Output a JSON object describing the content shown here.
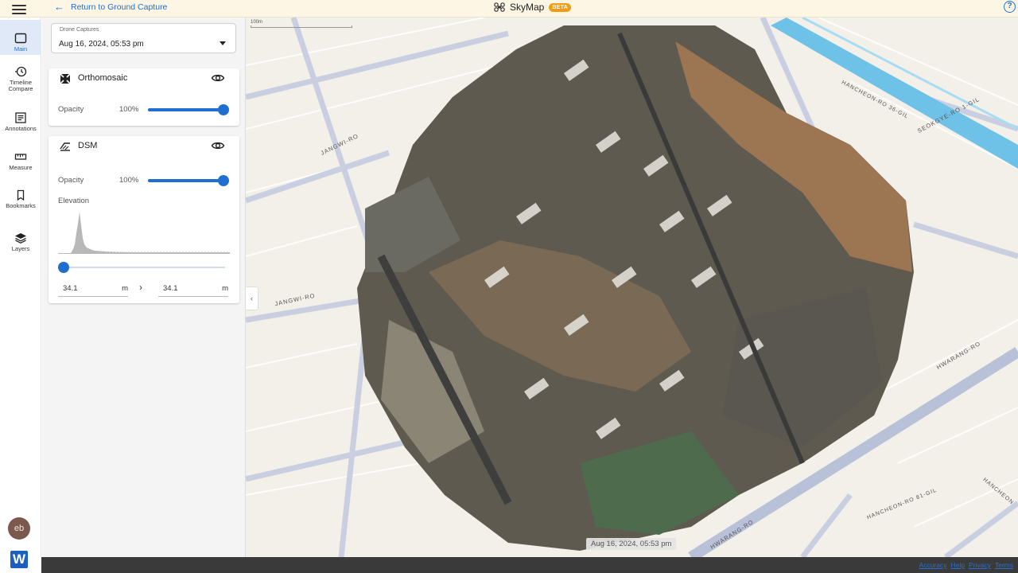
{
  "header": {
    "back_label": "Return to Ground Capture",
    "app_name": "SkyMap",
    "beta_badge": "BETA",
    "help_label": "?"
  },
  "rail": {
    "items": [
      {
        "label": "Main",
        "icon": "square-icon",
        "active": true
      },
      {
        "label": "Timeline Compare",
        "icon": "clock-history-icon"
      },
      {
        "label": "Annotations",
        "icon": "list-doc-icon"
      },
      {
        "label": "Measure",
        "icon": "ruler-icon"
      },
      {
        "label": "Bookmarks",
        "icon": "bookmark-icon"
      },
      {
        "label": "Layers",
        "icon": "layers-icon"
      }
    ],
    "avatar_initials": "eb",
    "logo_letter": "W"
  },
  "panel": {
    "capture_label": "Drone Captures",
    "capture_value": "Aug 16, 2024, 05:53 pm",
    "ortho": {
      "title": "Orthomosaic",
      "opacity_label": "Opacity",
      "opacity_value": "100%",
      "opacity_level": 1.0
    },
    "dsm": {
      "title": "DSM",
      "opacity_label": "Opacity",
      "opacity_value": "100%",
      "opacity_level": 1.0,
      "elevation_label": "Elevation",
      "min_value": "34.1",
      "max_value": "34.1",
      "unit": "m"
    }
  },
  "map": {
    "scale_label": "100m",
    "capture_date": "Aug 16, 2024, 05:53 pm",
    "street_labels": [
      "JANGWI-RO",
      "JANGWI-RO",
      "HWARANG-RO",
      "HWARANG-RO",
      "SEOKGYE-RO 1-GIL",
      "HANCHEON-RO 36-GIL",
      "HANCHEON-RO 81-GIL",
      "HANCHEON"
    ]
  },
  "footer": {
    "links": [
      "Accuracy",
      "Help",
      "Privacy",
      "Terms"
    ]
  },
  "colors": {
    "accent": "#1e6fd0",
    "beta": "#f39c12",
    "header_bg": "#fdf6e4"
  }
}
